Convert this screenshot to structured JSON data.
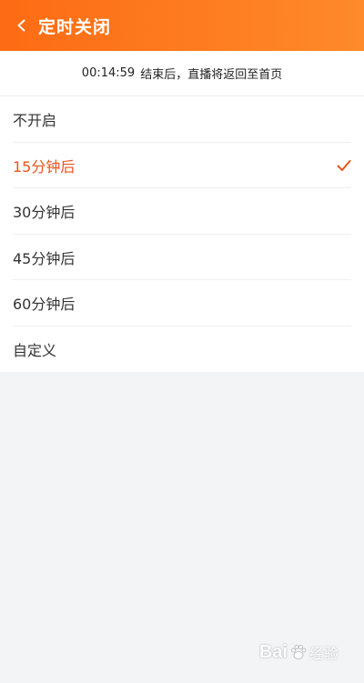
{
  "header": {
    "title": "定时关闭",
    "back_icon": "chevron-left-icon",
    "gradient_start": "#fd6b13",
    "gradient_end": "#fe8a2a"
  },
  "notice": {
    "time": "00:14:59",
    "text": "结束后，直播将返回至首页"
  },
  "options": [
    {
      "label": "不开启",
      "selected": false
    },
    {
      "label": "15分钟后",
      "selected": true
    },
    {
      "label": "30分钟后",
      "selected": false
    },
    {
      "label": "45分钟后",
      "selected": false
    },
    {
      "label": "60分钟后",
      "selected": false
    },
    {
      "label": "自定义",
      "selected": false
    }
  ],
  "selected_color": "#e9541d",
  "check_icon": "checkmark-icon",
  "watermark": {
    "brand": "Bai",
    "brand_suffix": "经验"
  }
}
